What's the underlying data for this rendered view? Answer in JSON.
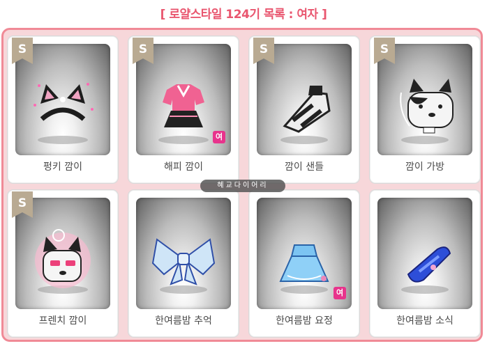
{
  "title": "[ 로얄스타일 124기 목록 : 여자 ]",
  "badge_letter": "S",
  "gender_mark": "여",
  "watermark": "혜교다이어리",
  "colors": {
    "title": "#e9566f",
    "frame_border": "#f08a96",
    "frame_fill": "#f7d7da",
    "badge": "#b9aa92",
    "gender_badge": "#e8338c"
  },
  "items": [
    {
      "label": "펑키 깜이",
      "icon": "cat-ear-headband-icon",
      "special": true,
      "female_only": false
    },
    {
      "label": "해피 깜이",
      "icon": "pink-outfit-icon",
      "special": true,
      "female_only": true
    },
    {
      "label": "깜이 샌들",
      "icon": "sandal-icon",
      "special": true,
      "female_only": false
    },
    {
      "label": "깜이 가방",
      "icon": "dog-bag-icon",
      "special": true,
      "female_only": false
    },
    {
      "label": "프렌치 깜이",
      "icon": "french-dog-icon",
      "special": true,
      "female_only": false
    },
    {
      "label": "한여름밤 추억",
      "icon": "ribbon-icon",
      "special": false,
      "female_only": false
    },
    {
      "label": "한여름밤 요정",
      "icon": "blue-dress-icon",
      "special": false,
      "female_only": true
    },
    {
      "label": "한여름밤 소식",
      "icon": "blue-slipper-icon",
      "special": false,
      "female_only": false
    }
  ]
}
